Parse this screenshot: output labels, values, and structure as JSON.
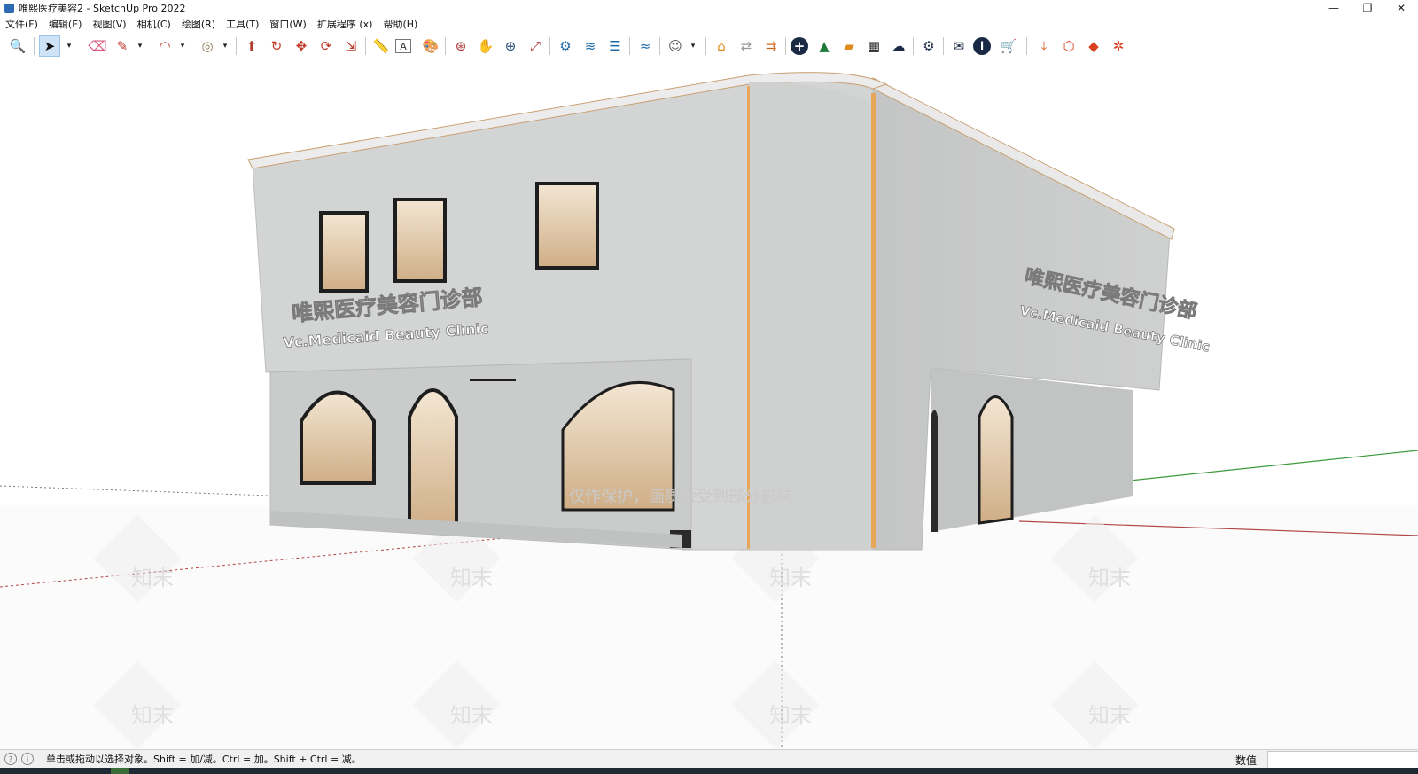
{
  "window": {
    "title": "唯熙医疗美容2 - SketchUp Pro 2022",
    "minimize_glyph": "—",
    "restore_glyph": "❐",
    "close_glyph": "✕"
  },
  "menu": [
    "文件(F)",
    "编辑(E)",
    "视图(V)",
    "相机(C)",
    "绘图(R)",
    "工具(T)",
    "窗口(W)",
    "扩展程序 (x)",
    "帮助(H)"
  ],
  "toolbar": {
    "icons": [
      {
        "name": "zoom-icon",
        "glyph": "🔍"
      },
      {
        "name": "select-arrow-icon",
        "glyph": "➤"
      },
      {
        "name": "eraser-icon",
        "glyph": "⌫"
      },
      {
        "name": "pencil-icon",
        "glyph": "✎"
      },
      {
        "name": "arc-icon",
        "glyph": "◠"
      },
      {
        "name": "circle-icon",
        "glyph": "◎"
      },
      {
        "name": "push-pull-icon",
        "glyph": "⬆"
      },
      {
        "name": "offset-icon",
        "glyph": "↻"
      },
      {
        "name": "move-icon",
        "glyph": "✥"
      },
      {
        "name": "rotate-icon",
        "glyph": "⟳"
      },
      {
        "name": "scale-icon",
        "glyph": "⇲"
      },
      {
        "name": "tape-measure-icon",
        "glyph": "📏"
      },
      {
        "name": "text-icon",
        "glyph": "A"
      },
      {
        "name": "paint-bucket-icon",
        "glyph": "🎨"
      },
      {
        "name": "orbit-icon",
        "glyph": "⊛"
      },
      {
        "name": "pan-icon",
        "glyph": "✋"
      },
      {
        "name": "zoom-tool-icon",
        "glyph": "⊕"
      },
      {
        "name": "zoom-extents-icon",
        "glyph": "⤢"
      },
      {
        "name": "components-icon",
        "glyph": "⚙"
      },
      {
        "name": "layers-icon",
        "glyph": "≋"
      },
      {
        "name": "styles-icon",
        "glyph": "☰"
      },
      {
        "name": "scenes-icon",
        "glyph": "≈"
      },
      {
        "name": "account-icon",
        "glyph": "☺"
      },
      {
        "name": "warehouse-icon",
        "glyph": "⌂"
      },
      {
        "name": "sync-icon",
        "glyph": "⇄"
      },
      {
        "name": "export-icon",
        "glyph": "⇉"
      },
      {
        "name": "add-icon",
        "glyph": "+"
      },
      {
        "name": "tree-icon",
        "glyph": "▲"
      },
      {
        "name": "sandbox-icon",
        "glyph": "▰"
      },
      {
        "name": "checker-icon",
        "glyph": "▦"
      },
      {
        "name": "cloud-upload-icon",
        "glyph": "☁"
      },
      {
        "name": "settings-icon",
        "glyph": "⚙"
      },
      {
        "name": "mail-icon",
        "glyph": "✉"
      },
      {
        "name": "info-icon",
        "glyph": "i"
      },
      {
        "name": "cart-icon",
        "glyph": "🛒"
      },
      {
        "name": "download-icon",
        "glyph": "⤓"
      },
      {
        "name": "ext-box-icon",
        "glyph": "⬡"
      },
      {
        "name": "ext-render-icon",
        "glyph": "◆"
      },
      {
        "name": "ext-gear-icon",
        "glyph": "✲"
      }
    ],
    "dropdown_glyph": "▾"
  },
  "model": {
    "sign_cn": "唯熙医疗美容门诊部",
    "sign_en": "Vc.Medicaid Beauty Clinic",
    "watermark_notice": "仅作保护，画质会受到部分影响",
    "watermark_logo": "知末",
    "colors": {
      "wall": "#d3d4d4",
      "wall_shadow": "#bcbdbd",
      "trim": "#e8a65a",
      "glass": "#e6d2b7",
      "frame": "#1e1e1e"
    }
  },
  "status": {
    "hint": "单击或拖动以选择对象。Shift = 加/减。Ctrl = 加。Shift + Ctrl = 减。",
    "value_label": "数值",
    "value": "",
    "icon_a": "?",
    "icon_b": "i"
  }
}
